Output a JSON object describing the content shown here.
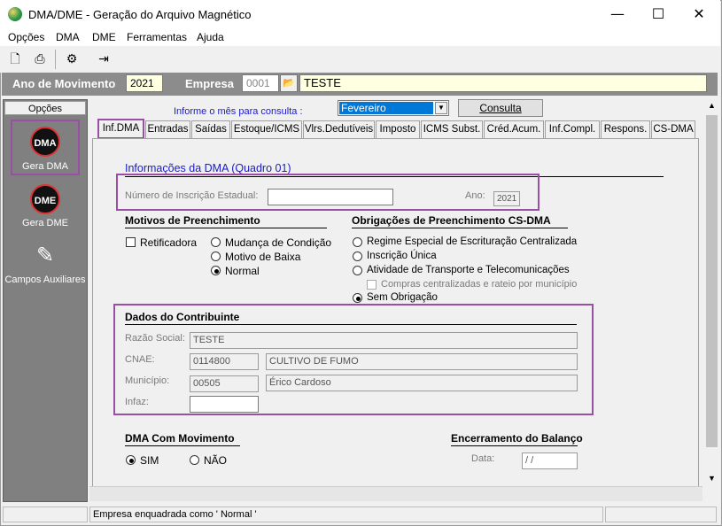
{
  "window": {
    "title": "DMA/DME - Geração do Arquivo Magnético",
    "min": "—",
    "max": "☐",
    "close": "✕"
  },
  "menu": [
    "Opções",
    "DMA",
    "DME",
    "Ferramentas",
    "Ajuda"
  ],
  "header": {
    "ano_label": "Ano de Movimento",
    "ano_value": "2021",
    "empresa_label": "Empresa",
    "empresa_code": "0001",
    "empresa_name": "TESTE"
  },
  "sidebar": {
    "title": "Opções",
    "items": [
      {
        "label": "Gera DMA",
        "icon": "DMA"
      },
      {
        "label": "Gera DME",
        "icon": "DME"
      },
      {
        "label": "Campos Auxiliares"
      }
    ]
  },
  "consulta": {
    "prompt": "Informe o mês para consulta :",
    "month": "Fevereiro",
    "button": "Consulta"
  },
  "tabs": [
    "Inf.DMA",
    "Entradas",
    "Saídas",
    "Estoque/ICMS",
    "Vlrs.Dedutíveis",
    "Imposto",
    "ICMS Subst.",
    "Créd.Acum.",
    "Inf.Compl.",
    "Respons.",
    "CS-DMA"
  ],
  "info": {
    "title": "Informações da DMA (Quadro 01)",
    "inscricao_label": "Número de Inscrição Estadual:",
    "inscricao_value": "",
    "ano_label": "Ano:",
    "ano_value": "2021"
  },
  "motivos": {
    "title": "Motivos de Preenchimento",
    "retificadora": "Retificadora",
    "options": [
      "Mudança de Condição",
      "Motivo de Baixa",
      "Normal"
    ]
  },
  "obrigacoes": {
    "title": "Obrigações de Preenchimento CS-DMA",
    "options": [
      "Regime Especial de Escrituração Centralizada",
      "Inscrição Única",
      "Atividade de Transporte e Telecomunicações"
    ],
    "sub": "Compras centralizadas e rateio por município",
    "sem": "Sem Obrigação"
  },
  "contribuinte": {
    "title": "Dados do Contribuinte",
    "razao_label": "Razão Social:",
    "razao_value": "TESTE",
    "cnae_label": "CNAE:",
    "cnae_code": "0114800",
    "cnae_desc": "CULTIVO DE FUMO",
    "municipio_label": "Município:",
    "municipio_code": "00505",
    "municipio_name": "Érico Cardoso",
    "infaz_label": "Infaz:",
    "infaz_value": ""
  },
  "movimento": {
    "title": "DMA Com Movimento",
    "sim": "SIM",
    "nao": "NÃO"
  },
  "encerramento": {
    "title": "Encerramento do Balanço",
    "data_label": "Data:",
    "data_value": " / /"
  },
  "status": "Empresa enquadrada como ' Normal '",
  "colors": {
    "accent": "#9b4ea6",
    "link": "#1a1acc"
  }
}
